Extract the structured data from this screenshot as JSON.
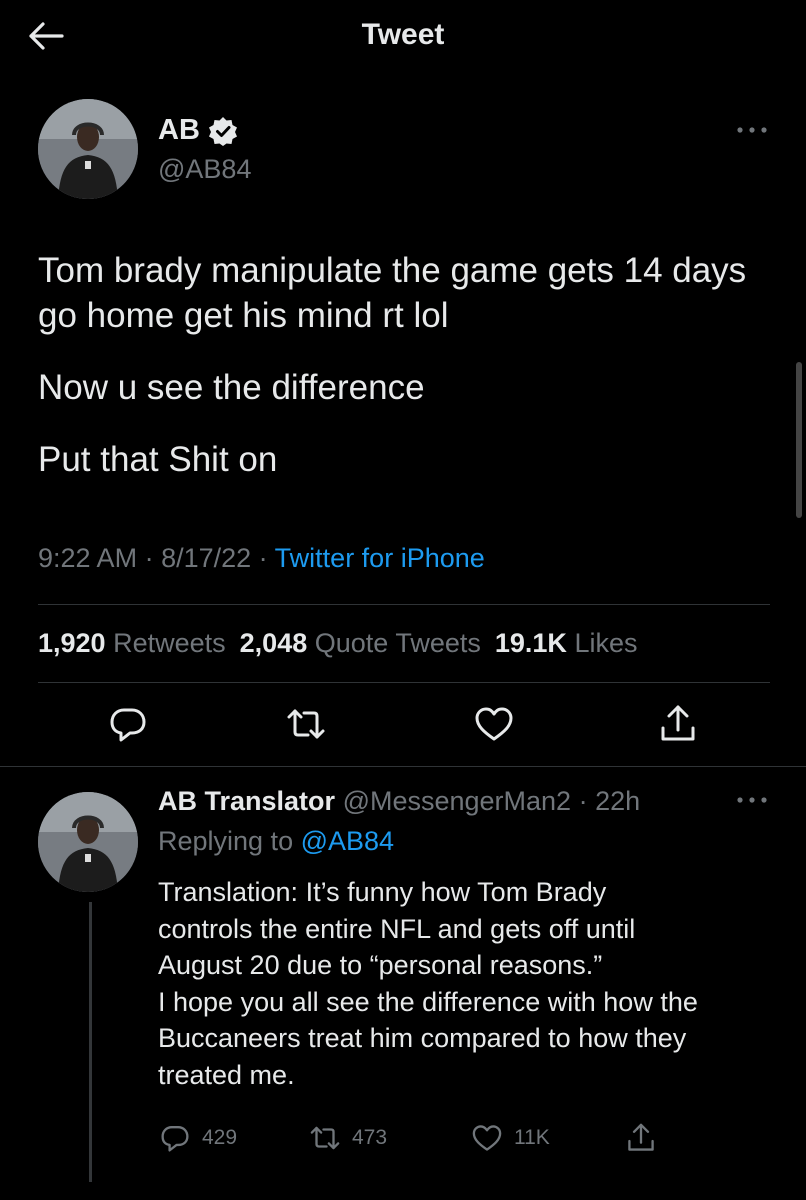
{
  "header": {
    "title": "Tweet"
  },
  "tweet": {
    "name": "AB",
    "handle": "@AB84",
    "text_lines": [
      "Tom brady manipulate the game gets 14 days  go home get his mind rt lol",
      "Now u see the difference",
      "Put that Shit on"
    ],
    "time": "9:22 AM",
    "date": "8/17/22",
    "source": "Twitter for iPhone",
    "stats": {
      "retweets_count": "1,920",
      "retweets_label": "Retweets",
      "quotes_count": "2,048",
      "quotes_label": "Quote Tweets",
      "likes_count": "19.1K",
      "likes_label": "Likes"
    }
  },
  "reply": {
    "name": "AB Translator",
    "handle": "@MessengerMan2",
    "age": "22h",
    "replying_prefix": "Replying to",
    "replying_handle": "@AB84",
    "text_lines": [
      "Translation: It’s funny how Tom Brady",
      "controls the entire NFL and gets off until",
      "August 20 due to “personal reasons.”",
      "I hope you all see the difference with how the",
      "Buccaneers treat him compared to how they",
      "treated me."
    ],
    "actions": {
      "replies": "429",
      "retweets": "473",
      "likes": "11K"
    }
  },
  "colors": {
    "background": "#000000",
    "text": "#e7e9ea",
    "muted": "#71767b",
    "link": "#1d9bf0",
    "divider": "#2f3336"
  },
  "icons": [
    "back-arrow-icon",
    "verified-badge-icon",
    "more-icon",
    "reply-icon",
    "retweet-icon",
    "like-icon",
    "share-icon"
  ]
}
